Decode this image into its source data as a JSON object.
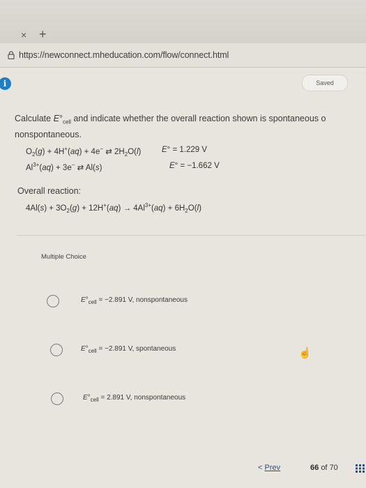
{
  "browser": {
    "tab_close": "×",
    "tab_new": "+",
    "url": "https://newconnect.mheducation.com/flow/connect.html"
  },
  "header": {
    "saved_label": "Saved"
  },
  "question": {
    "line1": "Calculate E°cell and indicate whether the overall reaction shown is spontaneous o",
    "line2": "nonspontaneous.",
    "half1_eq": "O2(g) + 4H+(aq) + 4e− ⇄ 2H2O(l)",
    "half1_e": "E° = 1.229 V",
    "half2_eq": "Al3+(aq) + 3e− ⇄ Al(s)",
    "half2_e": "E° = −1.662 V",
    "overall_label": "Overall reaction:",
    "overall_eq": "4Al(s) + 3O2(g) + 12H+(aq) → 4Al3+(aq) + 6H2O(l)"
  },
  "multiple_choice": {
    "label": "Multiple Choice",
    "options": [
      "E°cell = −2.891 V, nonspontaneous",
      "E°cell = −2.891 V, spontaneous",
      "E°cell = 2.891 V, nonspontaneous"
    ]
  },
  "footer": {
    "prev_label": "Prev",
    "prev_arrow": "<",
    "page_current": "66",
    "page_of": "of",
    "page_total": "70"
  },
  "icons": {
    "lock": "lock-icon",
    "info": "info-icon",
    "cursor": "hand-pointer-icon",
    "grid": "grid-icon"
  }
}
